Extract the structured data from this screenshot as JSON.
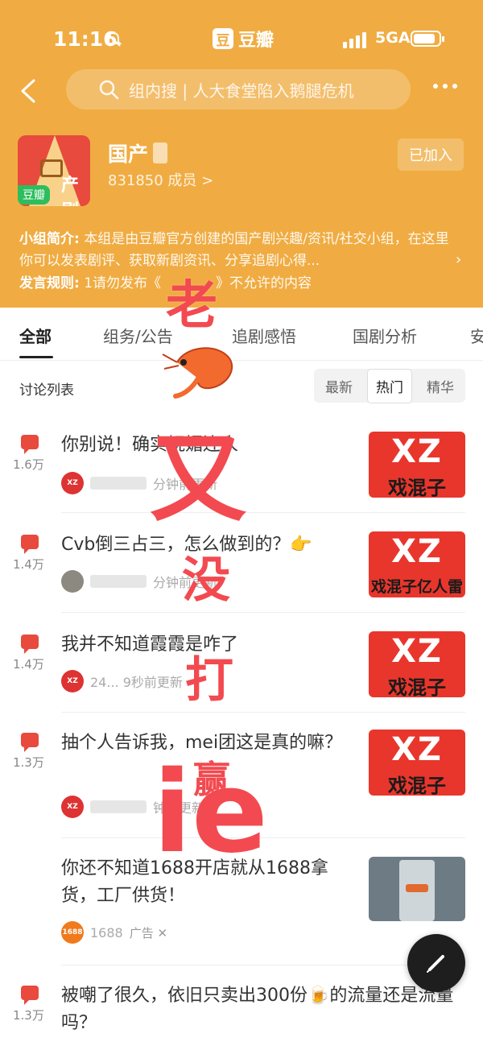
{
  "status_bar": {
    "time": "11:16",
    "app_name": "豆瓣",
    "app_logo_char": "豆",
    "network": "5GA",
    "icons": [
      "bell-muted-icon",
      "signal-icon",
      "battery-icon"
    ]
  },
  "header": {
    "search_placeholder": "组内搜 | 人大食堂陷入鹅腿危机",
    "group_name": "国产",
    "members": "831850 成员 >",
    "joined_label": "已加入",
    "icon_badge": "豆瓣",
    "icon_text": "产剧",
    "intro_label": "小组简介:",
    "intro_text": "本组是由豆瓣官方创建的国产剧兴趣/资讯/社交小组，在这里你可以发表剧评、获取新剧资讯、分享追剧心得...",
    "rules_label": "发言规则:",
    "rules_text": "1请勿发布《",
    "rules_text_tail": "》不允许的内容",
    "accent_color": "#f0ac42"
  },
  "tabs": [
    {
      "label": "全部"
    },
    {
      "label": "组务/公告"
    },
    {
      "label": "追剧感悟"
    },
    {
      "label": "国剧分析"
    },
    {
      "label": "安"
    }
  ],
  "list": {
    "title": "讨论列表",
    "sort_options": [
      "最新",
      "热门",
      "精华"
    ],
    "sort_selected": "热门"
  },
  "posts": [
    {
      "title": "你别说！确实妩媚连人",
      "count": "1.6万",
      "meta": "分钟前更新",
      "thumb_main": "XZ",
      "thumb_sub": "戏混子",
      "avatar_text": "XZ"
    },
    {
      "title": "Cvb倒三占三，怎么做到的？👉",
      "count": "1.4万",
      "meta": "分钟前更新",
      "thumb_main": "XZ",
      "thumb_sub": "戏混子亿人雷",
      "avatar_text": ""
    },
    {
      "title": "我并不知道霞霞是咋了",
      "count": "1.4万",
      "meta": "24... 9秒前更新",
      "thumb_main": "XZ",
      "thumb_sub": "戏混子",
      "avatar_text": "XZ"
    },
    {
      "title": "抽个人告诉我，mei团这是真的嘛？",
      "count": "1.3万",
      "meta": "钟前更新",
      "thumb_main": "XZ",
      "thumb_sub": "戏混子",
      "avatar_text": "XZ"
    },
    {
      "title": "你还不知道1688开店就从1688拿货，工厂供货！",
      "count": "",
      "meta": "1688",
      "ad_label": "广告 ✕",
      "avatar_text": "1688",
      "is_ad": true
    },
    {
      "title": "被嘲了很久，依旧只卖出300份🍺的流量还是流量吗？",
      "count": "1.3万",
      "meta": ""
    }
  ],
  "overlay_text": {
    "lao": "老",
    "you": "又",
    "mei": "没",
    "da": "打",
    "ying": "赢",
    "ie": "ie"
  },
  "fab_icon": "pen-icon"
}
